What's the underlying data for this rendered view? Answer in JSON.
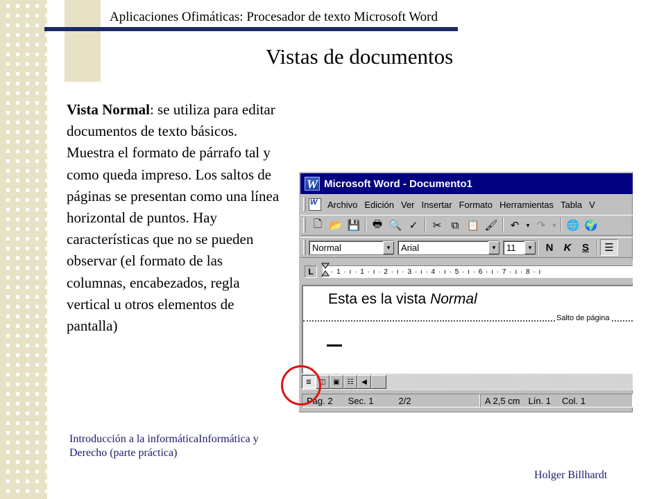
{
  "slide": {
    "header": "Aplicaciones Ofimáticas: Procesador de texto Microsoft Word",
    "title": "Vistas de documentos",
    "body_bold": "Vista Normal",
    "body_rest": ": se utiliza para editar documentos de texto básicos. Muestra el formato de párrafo tal y como queda impreso. Los saltos de páginas se presentan como una línea horizontal de puntos. Hay características que no se pueden observar (el formato de las columnas, encabezados, regla vertical u otros elementos de pantalla)",
    "footer_left": "Introducción a la informáticaInformática y Derecho (parte práctica)",
    "footer_right": "Holger Billhardt"
  },
  "word": {
    "window_title": "Microsoft Word - Documento1",
    "menu": [
      {
        "label": "Archivo"
      },
      {
        "label": "Edición"
      },
      {
        "label": "Ver"
      },
      {
        "label": "Insertar"
      },
      {
        "label": "Formato"
      },
      {
        "label": "Herramientas"
      },
      {
        "label": "Tabla"
      },
      {
        "label": "V"
      }
    ],
    "style_value": "Normal",
    "font_value": "Arial",
    "size_value": "11",
    "bold_label": "N",
    "italic_label": "K",
    "underline_label": "S",
    "tab_selector": "L",
    "ruler_text": "· 1 · ı · 1 · ı · 2 · ı · 3 · ı · 4 · ı · 5 · ı · 6 · ı · 7 · ı · 8 · ı",
    "doc_text_plain": "Esta es la vista ",
    "doc_text_italic": "Normal",
    "page_break_label": "Salto de página",
    "status": {
      "page": "Pág. 2",
      "section": "Sec. 1",
      "pages": "2/2",
      "at": "A 2,5 cm",
      "line": "Lín. 1",
      "col": "Col. 1"
    }
  }
}
